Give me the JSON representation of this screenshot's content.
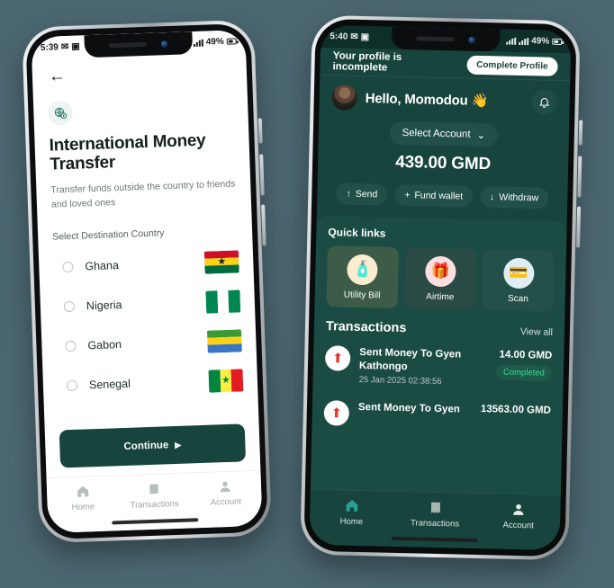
{
  "background_color": "#4b6771",
  "brand": {
    "dark_teal": "#17443c",
    "accent_green": "#2c9e8f",
    "status_green": "#3ddc91"
  },
  "left_phone": {
    "status_bar": {
      "time": "5:39",
      "battery": "49%",
      "icons": [
        "message-icon",
        "photo-icon",
        "signal-icon",
        "signal-icon",
        "battery-icon"
      ]
    },
    "back_icon": "←",
    "header_icon": "globe-money-icon",
    "title": "International Money Transfer",
    "subtitle": "Transfer funds outside the country to friends and loved ones",
    "select_label": "Select Destination Country",
    "countries": [
      {
        "name": "Ghana",
        "flag": "ghana-flag",
        "selected": false
      },
      {
        "name": "Nigeria",
        "flag": "nigeria-flag",
        "selected": false
      },
      {
        "name": "Gabon",
        "flag": "gabon-flag",
        "selected": false
      },
      {
        "name": "Senegal",
        "flag": "senegal-flag",
        "selected": false
      }
    ],
    "continue_label": "Continue",
    "tabs": [
      {
        "label": "Home",
        "icon": "home-icon",
        "active": false
      },
      {
        "label": "Transactions",
        "icon": "transactions-icon",
        "active": false
      },
      {
        "label": "Account",
        "icon": "account-icon",
        "active": false
      }
    ]
  },
  "right_phone": {
    "status_bar": {
      "time": "5:40",
      "battery": "49%",
      "icons": [
        "message-icon",
        "photo-icon",
        "signal-icon",
        "signal-icon",
        "battery-icon"
      ]
    },
    "banner": {
      "text": "Your profile is incomplete",
      "button": "Complete Profile"
    },
    "greeting": "Hello, Momodou 👋",
    "avatar": "user-avatar",
    "bell_icon": "bell-icon",
    "account_selector": "Select Account",
    "balance": "439.00 GMD",
    "actions": [
      {
        "label": "Send",
        "icon": "↑"
      },
      {
        "label": "Fund wallet",
        "icon": "+"
      },
      {
        "label": "Withdraw",
        "icon": "↓"
      }
    ],
    "quick_links_title": "Quick links",
    "quick_links": [
      {
        "label": "Utility Bill",
        "icon": "utility-bill-icon",
        "glyph": "🧴",
        "card_bg": "#3c5c48",
        "circle_bg": "#fbecd0"
      },
      {
        "label": "Airtime",
        "icon": "airtime-gift-icon",
        "glyph": "🎁",
        "card_bg": "#2a4a46",
        "circle_bg": "#fbdfe2"
      },
      {
        "label": "Scan",
        "icon": "scan-card-icon",
        "glyph": "💳",
        "card_bg": "#235049",
        "circle_bg": "#dfeef5"
      }
    ],
    "transactions_title": "Transactions",
    "view_all": "View all",
    "transactions": [
      {
        "name": "Sent Money To Gyen Kathongo",
        "date": "25 Jan 2025 02:38:56",
        "amount": "14.00 GMD",
        "status": "Completed",
        "icon": "sent-money-icon"
      },
      {
        "name": "Sent Money To Gyen",
        "date": "",
        "amount": "13563.00 GMD",
        "status": "",
        "icon": "sent-money-icon"
      }
    ],
    "tabs": [
      {
        "label": "Home",
        "icon": "home-icon",
        "active": true
      },
      {
        "label": "Transactions",
        "icon": "transactions-icon",
        "active": false
      },
      {
        "label": "Account",
        "icon": "account-icon",
        "active": false
      }
    ]
  }
}
